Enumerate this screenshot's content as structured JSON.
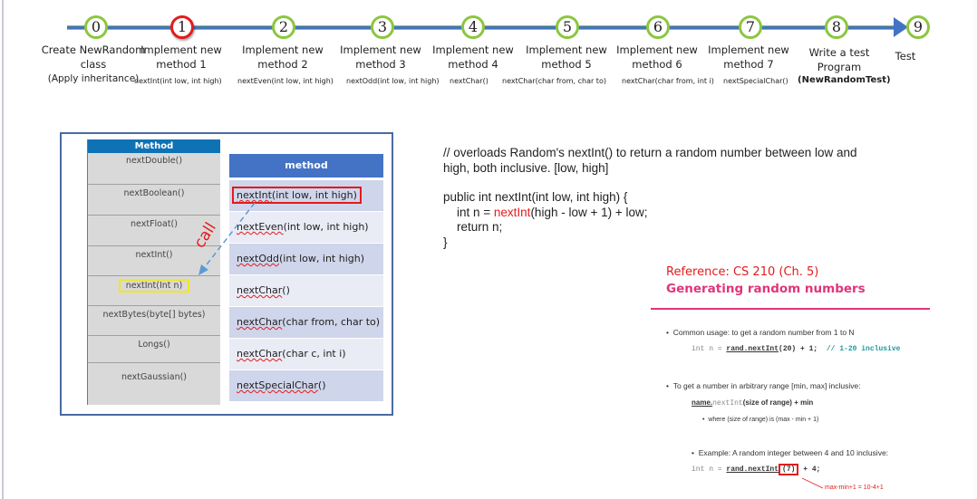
{
  "timeline": {
    "steps": [
      {
        "number": "0",
        "title": "Create NewRandom class",
        "note": "(Apply inheritance)",
        "sub": "",
        "active": false
      },
      {
        "number": "1",
        "title": "Implement new method 1",
        "note": "",
        "sub": "nextInt(int low, int high)",
        "active": true
      },
      {
        "number": "2",
        "title": "Implement new method 2",
        "note": "",
        "sub": "nextEven(int low, int high)",
        "active": false
      },
      {
        "number": "3",
        "title": "Implement new method 3",
        "note": "",
        "sub": "nextOdd(int low, int high)",
        "active": false
      },
      {
        "number": "4",
        "title": "Implement new method 4",
        "note": "",
        "sub": "nextChar()",
        "active": false
      },
      {
        "number": "5",
        "title": "Implement new method 5",
        "note": "",
        "sub": "nextChar(char from, char to)",
        "active": false
      },
      {
        "number": "6",
        "title": "Implement new method 6",
        "note": "",
        "sub": "nextChar(char from, int i)",
        "active": false
      },
      {
        "number": "7",
        "title": "Implement new method 7",
        "note": "",
        "sub": "nextSpecialChar()",
        "active": false
      },
      {
        "number": "8",
        "title": "Write a test Program",
        "note": "(NewRandomTest)",
        "sub": "",
        "active": false
      },
      {
        "number": "9",
        "title": "Test",
        "note": "",
        "sub": "",
        "active": false
      }
    ],
    "colors": {
      "line": "#4472c4",
      "ring": "#8cc63f",
      "active_ring": "#e31b1b"
    }
  },
  "random_table": {
    "header": "Method",
    "rows": [
      "nextDouble()",
      "nextBoolean()",
      "nextFloat()",
      "nextInt()",
      "nextInt(Int n)",
      "nextBytes(byte[] bytes)",
      "Longs()",
      "nextGaussian()"
    ],
    "highlighted": "nextInt(Int n)"
  },
  "new_table": {
    "header": "method",
    "rows": [
      {
        "name": "nextInt",
        "params": "(int low, int high)"
      },
      {
        "name": "nextEven",
        "params": "(int low, int high)"
      },
      {
        "name": "nextOdd",
        "params": "(int low, int high)"
      },
      {
        "name": "nextChar",
        "params": "()"
      },
      {
        "name": "nextChar",
        "params": "(char from, char to)"
      },
      {
        "name": "nextChar",
        "params": "(char c, int i)"
      },
      {
        "name": "nextSpecialChar",
        "params": "()"
      }
    ],
    "highlighted": "nextInt(int low, int high)"
  },
  "call_label": "call",
  "code": {
    "comment_line1": "// overloads Random's nextInt() to return a random number between low and",
    "comment_line2": "high, both inclusive. [low, high]",
    "signature": "public int nextInt(int low, int high) {",
    "body_prefix": "    int n = ",
    "body_call": "nextInt",
    "body_suffix": "(high - low + 1) + low;",
    "return_line": "    return n;",
    "closing": "}"
  },
  "reference": {
    "title": "Reference: CS 210 (Ch. 5)",
    "heading": "Generating random numbers",
    "bullet1": "Common usage: to get a random number from 1 to N",
    "code1_prefix": "int n = ",
    "code1_call": "rand.nextInt",
    "code1_args": "(20) + 1;",
    "code1_comment": "// 1-20 inclusive",
    "bullet2": "To get a number in arbitrary range [min, max] inclusive:",
    "formula_name": "name.",
    "formula_call": "nextInt",
    "formula_rest": "(size of range) + min",
    "where_text": "where (size of range) is (max - min + 1)",
    "bullet3": "Example: A random integer between 4 and 10 inclusive:",
    "code2_prefix": "int n = ",
    "code2_call": "rand.nextInt",
    "code2_arg": "(7)",
    "code2_suffix": " + 4;",
    "note": "max-min+1 = 10-4+1"
  }
}
